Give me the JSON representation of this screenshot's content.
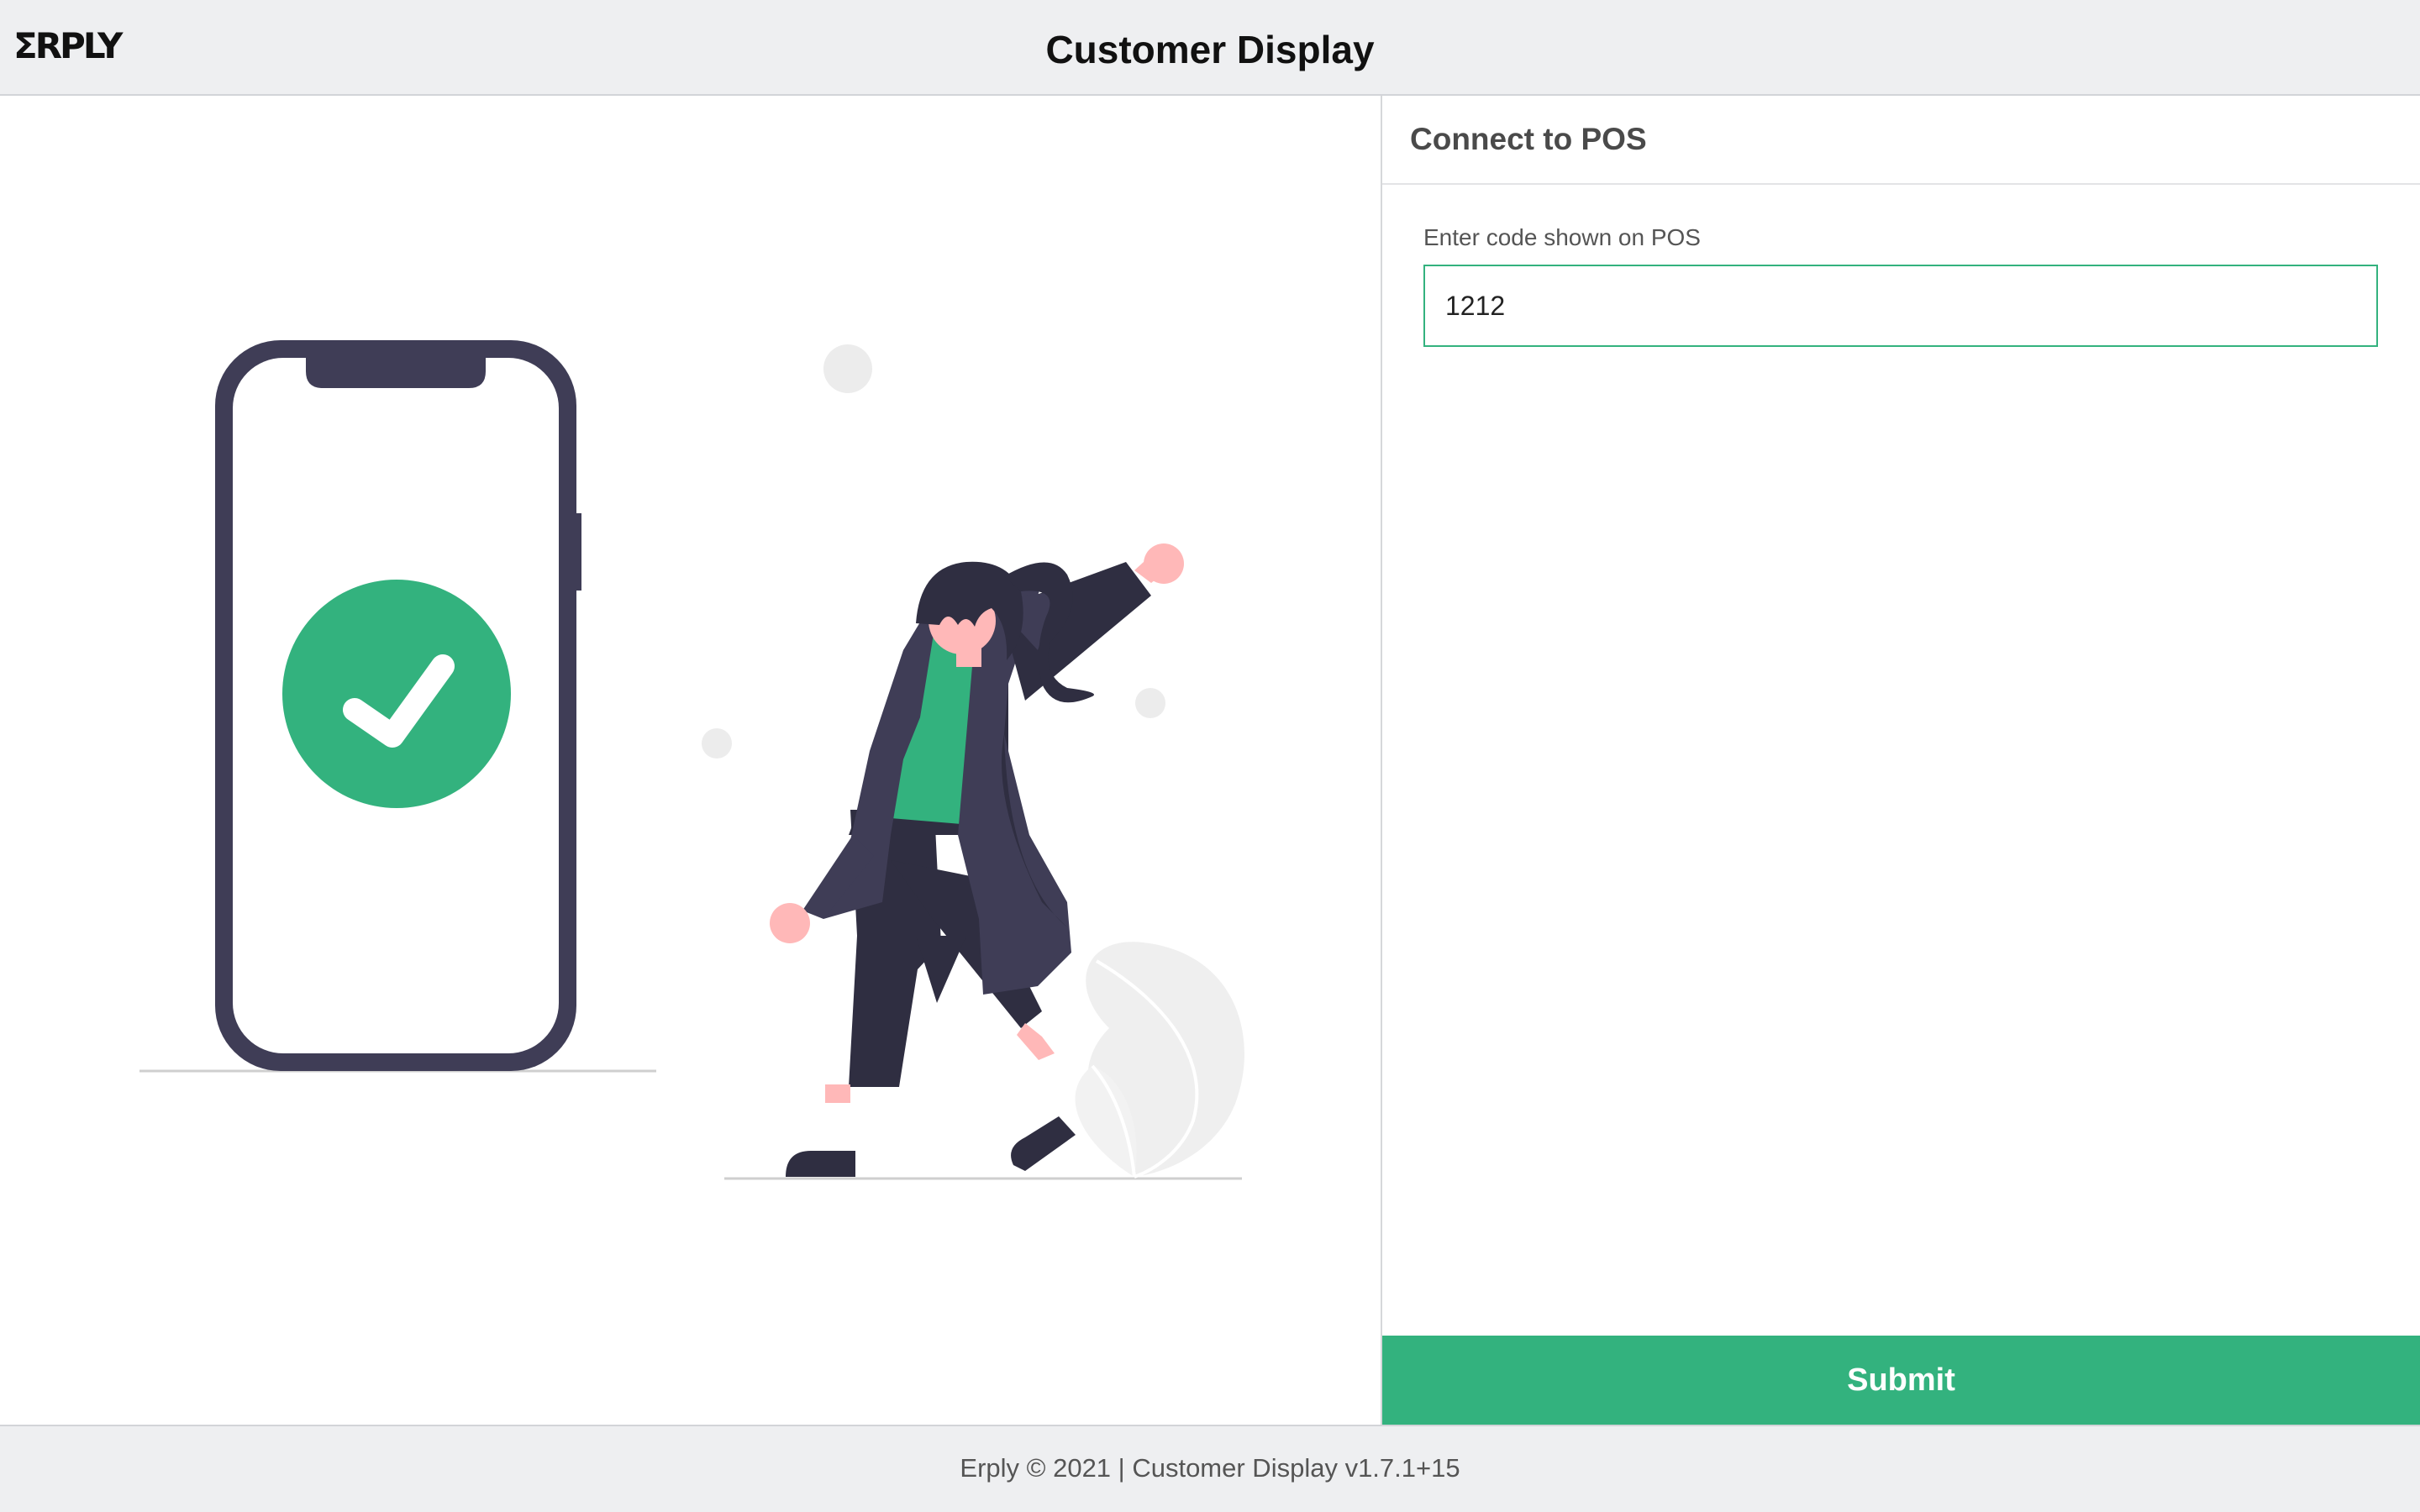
{
  "header": {
    "logo_text": "ΣRPLY",
    "title": "Customer Display"
  },
  "connect_panel": {
    "title": "Connect to POS",
    "code_label": "Enter code shown on POS",
    "code_value": "1212",
    "submit_label": "Submit"
  },
  "footer": {
    "text": "Erply © 2021 | Customer Display v1.7.1+15"
  },
  "illustration": {
    "icons": [
      "phone-icon",
      "checkmark-icon",
      "woman-figure",
      "leaf-plant"
    ]
  },
  "colors": {
    "accent": "#33b27e",
    "header_bg": "#eeeff1",
    "phone_frame": "#3f3d56",
    "figure_dark": "#2f2e41",
    "skin": "#ffb8b8"
  }
}
